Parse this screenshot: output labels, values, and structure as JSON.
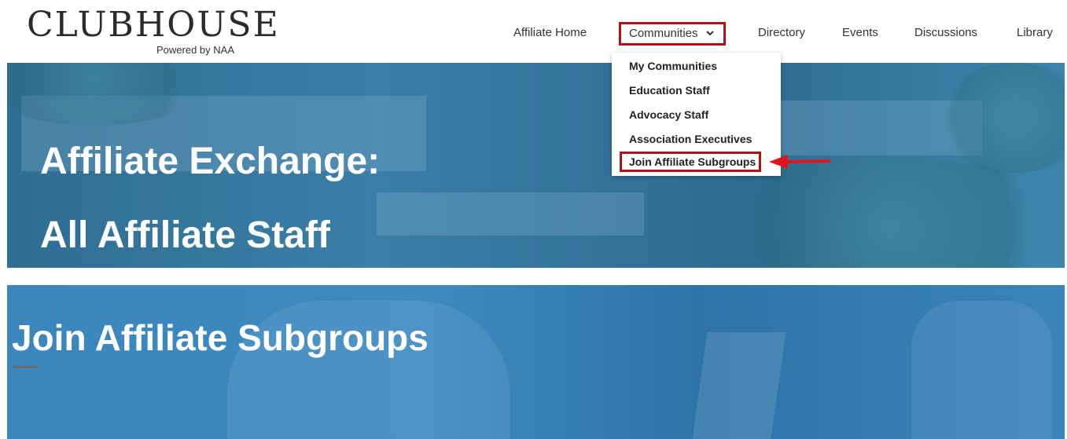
{
  "brand": {
    "logo_text": "CLUBHOUSE",
    "logo_sub": "Powered by NAA"
  },
  "nav": {
    "items": [
      {
        "label": "Affiliate Home"
      },
      {
        "label": "Communities"
      },
      {
        "label": "Directory"
      },
      {
        "label": "Events"
      },
      {
        "label": "Discussions"
      },
      {
        "label": "Library"
      }
    ]
  },
  "dropdown": {
    "items": [
      {
        "label": "My Communities"
      },
      {
        "label": "Education Staff"
      },
      {
        "label": "Advocacy Staff"
      },
      {
        "label": "Association Executives"
      },
      {
        "label": "Join Affiliate Subgroups"
      }
    ]
  },
  "hero_top": {
    "line1": "Affiliate Exchange:",
    "line2": "All Affiliate Staff"
  },
  "hero_bottom": {
    "title": "Join Affiliate Subgroups"
  },
  "colors": {
    "highlight_border": "#b01117",
    "hero_top_blue": "#3b7ea6",
    "hero_bottom_blue": "#3a86bd",
    "arrow_red": "#e3131b"
  },
  "icons": {
    "communities_caret": "chevron-down-icon",
    "annotation_arrow": "arrow-left-icon"
  }
}
